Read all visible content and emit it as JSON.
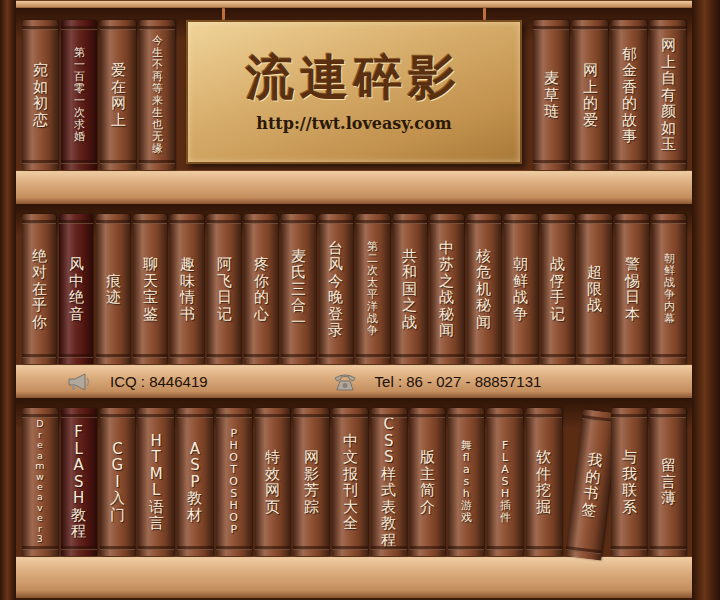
{
  "site": {
    "title": "流連碎影",
    "url": "http://twt.loveasy.com"
  },
  "top_shelf": {
    "left_books": [
      {
        "title": "宛如初恋",
        "kind": "normal",
        "color": "#8b4a2b"
      },
      {
        "title": "第一百零一次求婚",
        "kind": "small",
        "color": "#5c1812"
      },
      {
        "title": "爱在网上",
        "kind": "normal",
        "color": "#8b4a2b"
      },
      {
        "title": "今生不再等来生也无缘",
        "kind": "small",
        "color": "#8b4a2b"
      }
    ],
    "right_books": [
      {
        "title": "麦草琏",
        "kind": "normal",
        "color": "#8b4a2b"
      },
      {
        "title": "网上的爱",
        "kind": "normal",
        "color": "#8b4a2b"
      },
      {
        "title": "郁金香的故事",
        "kind": "normal",
        "color": "#8b4a2b"
      },
      {
        "title": "网上自有颜如玉",
        "kind": "normal",
        "color": "#8b4a2b"
      }
    ]
  },
  "middle_shelf": {
    "books": [
      {
        "title": "绝对在乎你",
        "kind": "normal",
        "color": "#8b4a2b"
      },
      {
        "title": "风中绝音",
        "kind": "normal",
        "color": "#5c1812"
      },
      {
        "title": "痕迹",
        "kind": "normal",
        "color": "#8b4a2b"
      },
      {
        "title": "聊天宝鉴",
        "kind": "normal",
        "color": "#8b4a2b"
      },
      {
        "title": "趣味情书",
        "kind": "normal",
        "color": "#8b4a2b"
      },
      {
        "title": "阿飞日记",
        "kind": "normal",
        "color": "#8b4a2b"
      },
      {
        "title": "疼你的心",
        "kind": "normal",
        "color": "#8b4a2b"
      },
      {
        "title": "麦氏三合一",
        "kind": "normal",
        "color": "#8b4a2b"
      },
      {
        "title": "台风今晚登录",
        "kind": "normal",
        "color": "#8b4a2b"
      },
      {
        "title": "第二次太平洋战争",
        "kind": "small",
        "color": "#8b4a2b"
      },
      {
        "title": "共和国之战",
        "kind": "normal",
        "color": "#8b4a2b"
      },
      {
        "title": "中苏之战秘闻",
        "kind": "normal",
        "color": "#8b4a2b"
      },
      {
        "title": "核危机秘闻",
        "kind": "normal",
        "color": "#8b4a2b"
      },
      {
        "title": "朝鲜战争",
        "kind": "normal",
        "color": "#8b4a2b"
      },
      {
        "title": "战俘手记",
        "kind": "normal",
        "color": "#8b4a2b"
      },
      {
        "title": "超限战",
        "kind": "normal",
        "color": "#8b4a2b"
      },
      {
        "title": "警惕日本",
        "kind": "normal",
        "color": "#8b4a2b"
      },
      {
        "title": "朝鲜战争内幕",
        "kind": "small",
        "color": "#8b4a2b"
      }
    ]
  },
  "contact": {
    "icq": "ICQ : 8446419",
    "tel": "Tel : 86 - 027 - 88857131"
  },
  "bottom_shelf": {
    "books": [
      {
        "title": "Dreamweaver 3",
        "kind": "tiny",
        "color": "#8b4a2b",
        "tilted": false
      },
      {
        "title": "FLASH 教程",
        "kind": "normal",
        "color": "#5c1812",
        "tilted": false
      },
      {
        "title": "CGI 入门",
        "kind": "normal",
        "color": "#8b4a2b",
        "tilted": false
      },
      {
        "title": "HTML语言",
        "kind": "normal",
        "color": "#8b4a2b",
        "tilted": false
      },
      {
        "title": "ASP 教材",
        "kind": "normal",
        "color": "#8b4a2b",
        "tilted": false
      },
      {
        "title": "PHOTOSHOP",
        "kind": "small",
        "color": "#8b4a2b",
        "tilted": false
      },
      {
        "title": "特效网页",
        "kind": "normal",
        "color": "#8b4a2b",
        "tilted": false
      },
      {
        "title": "网影芳踪",
        "kind": "normal",
        "color": "#8b4a2b",
        "tilted": false
      },
      {
        "title": "中文报刊大全",
        "kind": "normal",
        "color": "#8b4a2b",
        "tilted": false
      },
      {
        "title": "CSS样式表教程",
        "kind": "normal",
        "color": "#8b4a2b",
        "tilted": false
      },
      {
        "title": "版主简介",
        "kind": "normal",
        "color": "#8b4a2b",
        "tilted": false
      },
      {
        "title": "舞 flash 游戏",
        "kind": "small",
        "color": "#8b4a2b",
        "tilted": false
      },
      {
        "title": "FLASH 插件",
        "kind": "small",
        "color": "#8b4a2b",
        "tilted": false
      },
      {
        "title": "软件挖掘",
        "kind": "normal",
        "color": "#8b4a2b",
        "tilted": false
      },
      {
        "title": "我的书签",
        "kind": "normal",
        "color": "#8b4a2b",
        "tilted": true
      },
      {
        "title": "与我联系",
        "kind": "normal",
        "color": "#8b4a2b",
        "tilted": false
      },
      {
        "title": "留言薄",
        "kind": "normal",
        "color": "#8b4a2b",
        "tilted": false
      }
    ]
  }
}
